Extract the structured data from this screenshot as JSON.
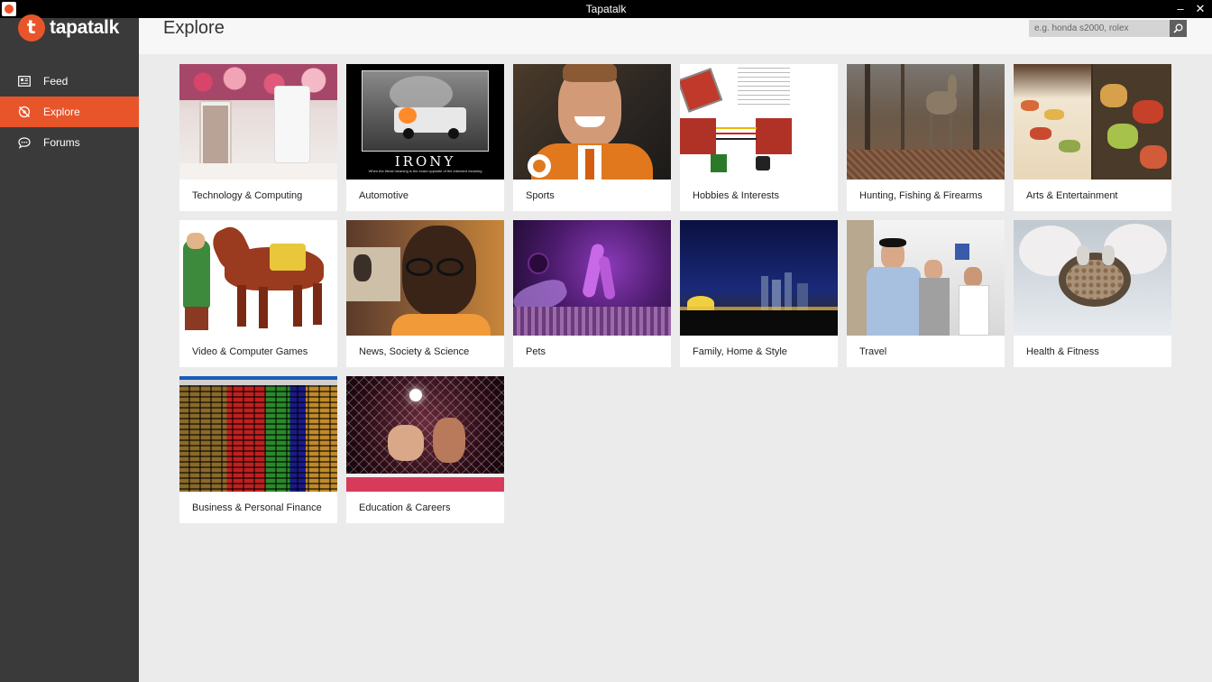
{
  "window": {
    "title": "Tapatalk"
  },
  "sidebar": {
    "logo_text": "tapatalk",
    "items": [
      {
        "label": "Feed",
        "icon": "feed-icon"
      },
      {
        "label": "Explore",
        "icon": "explore-icon",
        "active": true
      },
      {
        "label": "Forums",
        "icon": "forums-icon"
      }
    ]
  },
  "header": {
    "title": "Explore",
    "search_placeholder": "e.g. honda s2000, rolex"
  },
  "colors": {
    "accent": "#e8552a",
    "sidebar": "#3a3a3a",
    "background": "#ebebeb"
  },
  "categories": [
    {
      "label": "Technology & Computing"
    },
    {
      "label": "Automotive",
      "image_caption_title": "IRONY",
      "image_caption_sub": "When the literal meaning is the exact opposite of the intended meaning"
    },
    {
      "label": "Sports"
    },
    {
      "label": "Hobbies & Interests"
    },
    {
      "label": "Hunting, Fishing & Firearms"
    },
    {
      "label": "Arts & Entertainment"
    },
    {
      "label": "Video & Computer Games"
    },
    {
      "label": "News, Society & Science"
    },
    {
      "label": "Pets"
    },
    {
      "label": "Family, Home & Style"
    },
    {
      "label": "Travel"
    },
    {
      "label": "Health & Fitness"
    },
    {
      "label": "Business & Personal Finance"
    },
    {
      "label": "Education & Careers"
    }
  ]
}
